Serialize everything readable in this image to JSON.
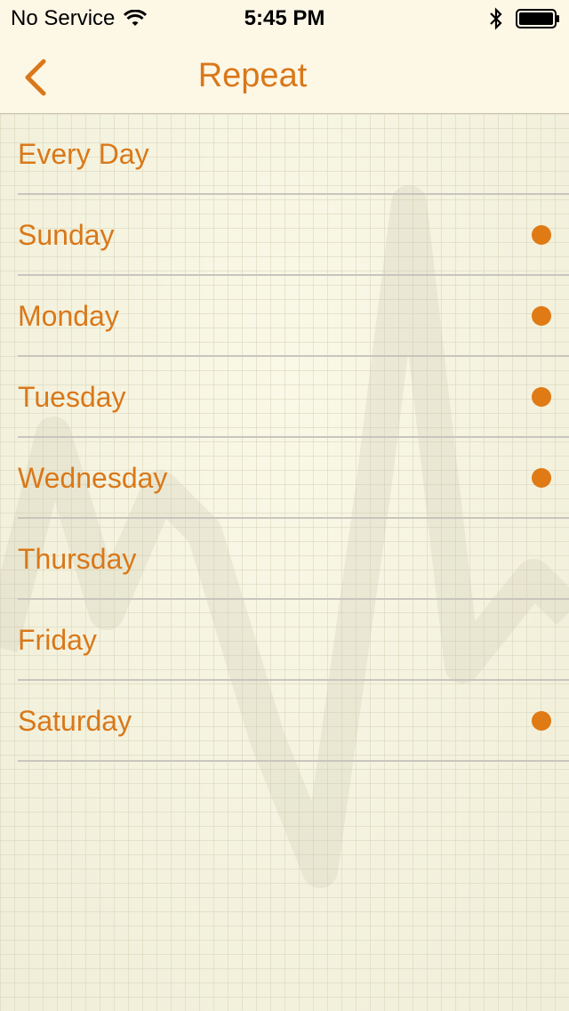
{
  "status_bar": {
    "carrier": "No Service",
    "time": "5:45 PM",
    "icons": [
      "wifi-icon",
      "bluetooth-icon",
      "battery-icon"
    ]
  },
  "nav": {
    "title": "Repeat",
    "back_icon": "chevron-left-icon"
  },
  "colors": {
    "accent": "#d9781a",
    "dot": "#e07a14",
    "bar_background": "#fdf7e6",
    "separator": "#c8c6bd"
  },
  "rows": [
    {
      "label": "Every Day",
      "selected": false
    },
    {
      "label": "Sunday",
      "selected": true
    },
    {
      "label": "Monday",
      "selected": true
    },
    {
      "label": "Tuesday",
      "selected": true
    },
    {
      "label": "Wednesday",
      "selected": true
    },
    {
      "label": "Thursday",
      "selected": false
    },
    {
      "label": "Friday",
      "selected": false
    },
    {
      "label": "Saturday",
      "selected": true
    }
  ]
}
